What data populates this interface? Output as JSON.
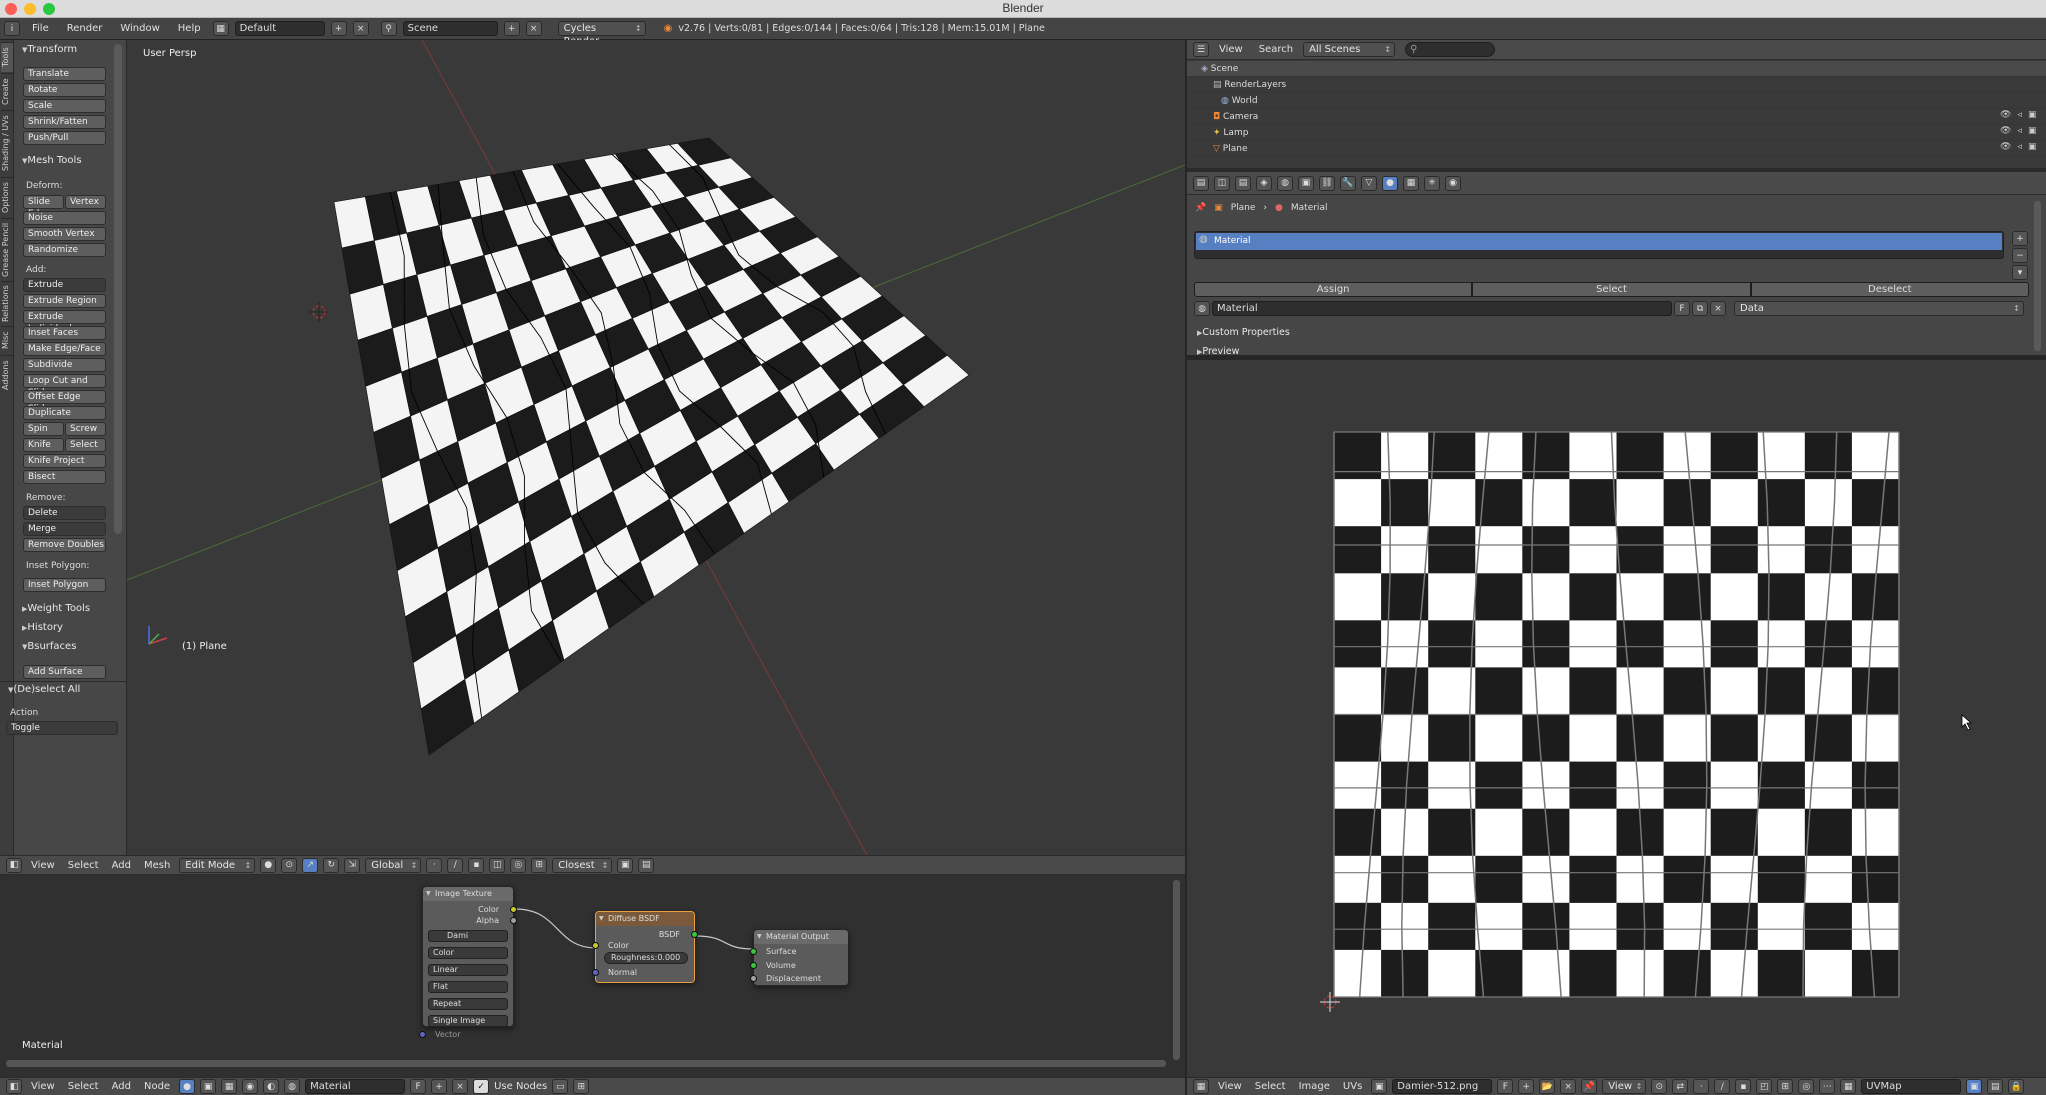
{
  "window": {
    "title": "Blender"
  },
  "infobar": {
    "menus": [
      "File",
      "Render",
      "Window",
      "Help"
    ],
    "screen_layout": "Default",
    "scene": "Scene",
    "render_engine": "Cycles Render",
    "stats": "v2.76 | Verts:0/81 | Edges:0/144 | Faces:0/64 | Tris:128 | Mem:15.01M | Plane"
  },
  "toolshelf": {
    "tabs": [
      "Tools",
      "Create",
      "Shading / UVs",
      "Options",
      "Grease Pencil",
      "Relations",
      "Misc",
      "Addons"
    ],
    "transform": {
      "header": "Transform",
      "buttons": [
        "Translate",
        "Rotate",
        "Scale",
        "Shrink/Fatten",
        "Push/Pull"
      ]
    },
    "mesh_tools": {
      "header": "Mesh Tools",
      "deform_label": "Deform:",
      "slide_edge": "Slide Ed",
      "vertex": "Vertex",
      "noise": "Noise",
      "smooth_vertex": "Smooth Vertex",
      "randomize": "Randomize",
      "add_label": "Add:",
      "extrude": "Extrude",
      "add_buttons": [
        "Extrude Region",
        "Extrude Individual",
        "Inset Faces",
        "Make Edge/Face",
        "Subdivide",
        "Loop Cut and Slide",
        "Offset Edge Slide",
        "Duplicate"
      ],
      "spin": "Spin",
      "screw": "Screw",
      "knife": "Knife",
      "select": "Select",
      "knife_project": "Knife Project",
      "bisect": "Bisect",
      "remove_label": "Remove:",
      "delete": "Delete",
      "merge": "Merge",
      "remove_doubles": "Remove Doubles",
      "inset_polygon_label": "Inset Polygon:",
      "inset_polygon": "Inset Polygon"
    },
    "weight_tools": "Weight Tools",
    "history": "History",
    "bsurfaces": "Bsurfaces",
    "add_surface": "Add Surface",
    "operator": {
      "header": "(De)select All",
      "action_label": "Action",
      "action_value": "Toggle"
    }
  },
  "viewport": {
    "view_name": "User Persp",
    "object_label": "(1) Plane",
    "header": {
      "menus": [
        "View",
        "Select",
        "Add",
        "Mesh"
      ],
      "mode": "Edit Mode",
      "orientation": "Global",
      "snap": "Closest"
    }
  },
  "node_editor": {
    "material_label": "Material",
    "image_texture": {
      "title": "Image Texture",
      "out_color": "Color",
      "out_alpha": "Alpha",
      "image_name": "Dami",
      "color_mode": "Color",
      "interpolation": "Linear",
      "projection": "Flat",
      "extension": "Repeat",
      "source": "Single Image",
      "in_vector": "Vector"
    },
    "diffuse": {
      "title": "Diffuse BSDF",
      "out_bsdf": "BSDF",
      "in_color": "Color",
      "roughness": "Roughness:0.000",
      "in_normal": "Normal"
    },
    "output": {
      "title": "Material Output",
      "surface": "Surface",
      "volume": "Volume",
      "displacement": "Displacement"
    },
    "header": {
      "menus": [
        "View",
        "Select",
        "Add",
        "Node"
      ],
      "material": "Material",
      "use_nodes": "Use Nodes"
    }
  },
  "outliner": {
    "header": {
      "view": "View",
      "search": "Search",
      "filter": "All Scenes"
    },
    "rows": [
      {
        "name": "Scene",
        "indent": 0
      },
      {
        "name": "RenderLayers",
        "indent": 1
      },
      {
        "name": "World",
        "indent": 1
      },
      {
        "name": "Camera",
        "indent": 1
      },
      {
        "name": "Lamp",
        "indent": 1
      },
      {
        "name": "Plane",
        "indent": 1
      }
    ]
  },
  "properties": {
    "breadcrumb": [
      "Plane",
      "Material"
    ],
    "slot": "Material",
    "assign": "Assign",
    "select": "Select",
    "deselect": "Deselect",
    "material_name": "Material",
    "f_label": "F",
    "link": "Data",
    "custom_properties": "Custom Properties",
    "preview": "Preview"
  },
  "uv_editor": {
    "header": {
      "menus": [
        "View",
        "Select",
        "Image",
        "UVs"
      ],
      "image": "Damier-512.png",
      "f_label": "F",
      "view": "View",
      "uvmap": "UVMap"
    }
  },
  "colors": {
    "selection_blue": "#5680c2",
    "background": "#393939",
    "panel": "#474747"
  }
}
